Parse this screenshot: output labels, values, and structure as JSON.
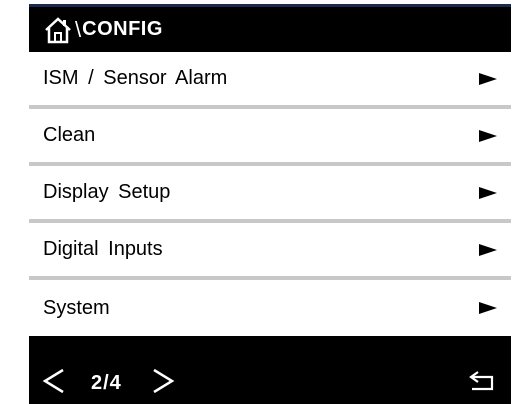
{
  "header": {
    "home_icon": "home-icon",
    "separator": "\\",
    "title": "CONFIG"
  },
  "menu": {
    "items": [
      {
        "label": "ISM / Sensor Alarm",
        "icon": "arrow-right-icon"
      },
      {
        "label": "Clean",
        "icon": "arrow-right-icon"
      },
      {
        "label": "Display Setup",
        "icon": "arrow-right-icon"
      },
      {
        "label": "Digital Inputs",
        "icon": "arrow-right-icon"
      },
      {
        "label": "System",
        "icon": "arrow-right-icon"
      }
    ]
  },
  "footer": {
    "prev_icon": "chevron-left-icon",
    "page_indicator": "2/4",
    "next_icon": "chevron-right-icon",
    "back_icon": "return-icon"
  },
  "colors": {
    "background": "#000000",
    "item_bg": "#ffffff",
    "divider": "#c8c8c8",
    "text_light": "#ffffff",
    "text_dark": "#000000"
  }
}
